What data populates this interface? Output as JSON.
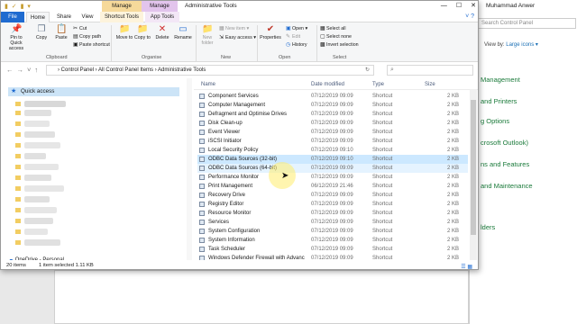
{
  "titlebar": {
    "manage_tab_1": "Manage",
    "manage_tab_2": "Manage",
    "title": "Administrative Tools",
    "minimize": "—",
    "maximize": "☐",
    "close": "✕"
  },
  "tabs": {
    "file": "File",
    "home": "Home",
    "share": "Share",
    "view": "View",
    "shortcut_tools": "Shortcut Tools",
    "app_tools": "App Tools"
  },
  "ribbon": {
    "pin": "Pin to Quick access",
    "copy": "Copy",
    "paste": "Paste",
    "cut": "Cut",
    "copy_path": "Copy path",
    "paste_shortcut": "Paste shortcut",
    "clipboard_label": "Clipboard",
    "move_to": "Move to",
    "copy_to": "Copy to",
    "delete": "Delete",
    "rename": "Rename",
    "organise_label": "Organise",
    "new_folder": "New folder",
    "new_item": "New item",
    "easy_access": "Easy access",
    "new_label": "New",
    "properties": "Properties",
    "open": "Open",
    "edit": "Edit",
    "history": "History",
    "open_label": "Open",
    "select_all": "Select all",
    "select_none": "Select none",
    "invert_selection": "Invert selection",
    "select_label": "Select"
  },
  "address": {
    "path": "›  Control Panel  ›  All Control Panel Items  ›  Administrative Tools"
  },
  "navpane": {
    "quick_access": "Quick access",
    "onedrive": "OneDrive - Personal"
  },
  "columns": {
    "name": "Name",
    "date": "Date modified",
    "type": "Type",
    "size": "Size"
  },
  "files": [
    {
      "name": "Component Services",
      "date": "07/12/2019 09:09",
      "type": "Shortcut",
      "size": "2 KB"
    },
    {
      "name": "Computer Management",
      "date": "07/12/2019 09:09",
      "type": "Shortcut",
      "size": "2 KB"
    },
    {
      "name": "Defragment and Optimise Drives",
      "date": "07/12/2019 09:09",
      "type": "Shortcut",
      "size": "2 KB"
    },
    {
      "name": "Disk Clean-up",
      "date": "07/12/2019 09:09",
      "type": "Shortcut",
      "size": "2 KB"
    },
    {
      "name": "Event Viewer",
      "date": "07/12/2019 09:09",
      "type": "Shortcut",
      "size": "2 KB"
    },
    {
      "name": "iSCSI Initiator",
      "date": "07/12/2019 09:09",
      "type": "Shortcut",
      "size": "2 KB"
    },
    {
      "name": "Local Security Policy",
      "date": "07/12/2019 09:10",
      "type": "Shortcut",
      "size": "2 KB"
    },
    {
      "name": "ODBC Data Sources (32-bit)",
      "date": "07/12/2019 09:10",
      "type": "Shortcut",
      "size": "2 KB"
    },
    {
      "name": "ODBC Data Sources (64-bit)",
      "date": "07/12/2019 09:09",
      "type": "Shortcut",
      "size": "2 KB"
    },
    {
      "name": "Performance Monitor",
      "date": "07/12/2019 09:09",
      "type": "Shortcut",
      "size": "2 KB"
    },
    {
      "name": "Print Management",
      "date": "06/12/2019 21:46",
      "type": "Shortcut",
      "size": "2 KB"
    },
    {
      "name": "Recovery Drive",
      "date": "07/12/2019 09:09",
      "type": "Shortcut",
      "size": "2 KB"
    },
    {
      "name": "Registry Editor",
      "date": "07/12/2019 09:09",
      "type": "Shortcut",
      "size": "2 KB"
    },
    {
      "name": "Resource Monitor",
      "date": "07/12/2019 09:09",
      "type": "Shortcut",
      "size": "2 KB"
    },
    {
      "name": "Services",
      "date": "07/12/2019 09:09",
      "type": "Shortcut",
      "size": "2 KB"
    },
    {
      "name": "System Configuration",
      "date": "07/12/2019 09:09",
      "type": "Shortcut",
      "size": "2 KB"
    },
    {
      "name": "System Information",
      "date": "07/12/2019 09:09",
      "type": "Shortcut",
      "size": "2 KB"
    },
    {
      "name": "Task Scheduler",
      "date": "07/12/2019 09:09",
      "type": "Shortcut",
      "size": "2 KB"
    },
    {
      "name": "Windows Defender Firewall with Advanc",
      "date": "07/12/2019 09:09",
      "type": "Shortcut",
      "size": "2 KB"
    }
  ],
  "statusbar": {
    "count": "20 items",
    "selection": "1 item selected  1.11 KB"
  },
  "background_window": {
    "user": "Muhammad Anwer",
    "search_placeholder": "Search Control Panel",
    "view_by_label": "View by:",
    "view_by_value": "Large icons ▾",
    "links": [
      "Management",
      "and Printers",
      "g Options",
      "crosoft Outlook)",
      "ns and Features",
      "and Maintenance",
      "lders"
    ]
  },
  "colors": {
    "file_tab": "#1f6bd0",
    "selected_row": "#cce8ff",
    "manage_1": "#f6d99a",
    "manage_2": "#e2c4ec",
    "link_green": "#1a7a3a"
  }
}
